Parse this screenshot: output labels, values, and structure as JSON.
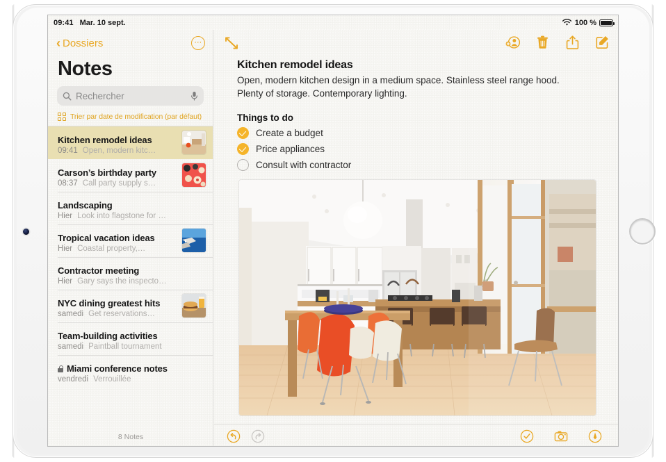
{
  "status_bar": {
    "time": "09:41",
    "date": "Mar. 10 sept.",
    "battery_percent": "100 %",
    "wifi_icon": "wifi-icon",
    "battery_icon": "battery-full-icon"
  },
  "sidebar": {
    "back_label": "Dossiers",
    "back_icon": "chevron-left-icon",
    "more_icon": "ellipsis-circle-icon",
    "title": "Notes",
    "search": {
      "placeholder": "Rechercher",
      "search_icon": "search-icon",
      "mic_icon": "microphone-icon"
    },
    "sort": {
      "label": "Trier par date de modification (par défaut)",
      "grid_icon": "grid-icon",
      "chevron_icon": "chevron-down-icon"
    },
    "notes": [
      {
        "title": "Kitchen remodel ideas",
        "date": "09:41",
        "preview": "Open, modern kitc…",
        "thumb": "kitchen",
        "locked": false,
        "selected": true
      },
      {
        "title": "Carson’s birthday party",
        "date": "08:37",
        "preview": "Call party supply s…",
        "thumb": "party",
        "locked": false,
        "selected": false
      },
      {
        "title": "Landscaping",
        "date": "Hier",
        "preview": "Look into flagstone for ba…",
        "thumb": "",
        "locked": false,
        "selected": false
      },
      {
        "title": "Tropical vacation ideas",
        "date": "Hier",
        "preview": "Coastal property,…",
        "thumb": "coastal",
        "locked": false,
        "selected": false
      },
      {
        "title": "Contractor meeting",
        "date": "Hier",
        "preview": "Gary says the inspector will…",
        "thumb": "",
        "locked": false,
        "selected": false
      },
      {
        "title": "NYC dining greatest hits",
        "date": "samedi",
        "preview": "Get reservations…",
        "thumb": "food",
        "locked": false,
        "selected": false
      },
      {
        "title": "Team-building activities",
        "date": "samedi",
        "preview": "Paintball tournament",
        "thumb": "",
        "locked": false,
        "selected": false
      },
      {
        "title": "Miami conference notes",
        "date": "vendredi",
        "preview": "Verrouillée",
        "thumb": "",
        "locked": true,
        "selected": false
      }
    ],
    "footer_count": "8 Notes"
  },
  "detail": {
    "toolbar": {
      "expand_icon": "expand-diagonal-icon",
      "add_people_icon": "add-person-icon",
      "delete_icon": "trash-icon",
      "share_icon": "share-icon",
      "compose_icon": "compose-icon"
    },
    "note": {
      "title": "Kitchen remodel ideas",
      "body": "Open, modern kitchen design in a medium space. Stainless steel range hood. Plenty of storage. Contemporary lighting.",
      "checklist_heading": "Things to do",
      "checklist": [
        {
          "label": "Create a budget",
          "checked": true
        },
        {
          "label": "Price appliances",
          "checked": true
        },
        {
          "label": "Consult with contractor",
          "checked": false
        }
      ],
      "photo_alt": "Modern open kitchen with island, bar stools, orange chairs and wood dining table"
    },
    "bottom_toolbar": {
      "undo_icon": "undo-icon",
      "redo_icon": "redo-icon",
      "checklist_icon": "checklist-circle-icon",
      "camera_icon": "camera-icon",
      "markup_icon": "markup-pen-icon"
    }
  },
  "colors": {
    "accent": "#e9a825",
    "check_fill": "#f5b42a",
    "selected_row": "#e9dfb2",
    "paper": "#f7f6f3",
    "disabled": "#c9c7c4"
  }
}
